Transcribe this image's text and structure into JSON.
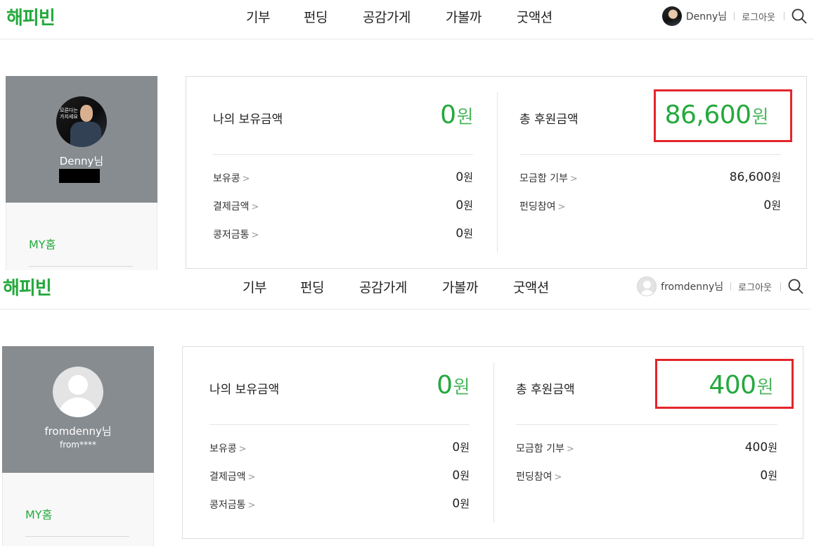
{
  "screens": [
    {
      "header": {
        "logo": "해피빈",
        "nav": [
          "기부",
          "펀딩",
          "공감가게",
          "가볼까",
          "굿액션"
        ],
        "user_name": "Denny님",
        "logout": "로그아웃"
      },
      "profile": {
        "name": "Denny님",
        "id_masked": "",
        "photo_caption": "모른다는\n가지세요",
        "my_home": "MY홈"
      },
      "balance": {
        "label": "나의 보유금액",
        "value": "0",
        "unit": "원",
        "items": [
          {
            "label": "보유콩",
            "value": "0",
            "unit": "원"
          },
          {
            "label": "결제금액",
            "value": "0",
            "unit": "원"
          },
          {
            "label": "콩저금통",
            "value": "0",
            "unit": "원"
          }
        ]
      },
      "donation": {
        "label": "총 후원금액",
        "value": "86,600",
        "unit": "원",
        "items": [
          {
            "label": "모금함 기부",
            "value": "86,600",
            "unit": "원"
          },
          {
            "label": "펀딩참여",
            "value": "0",
            "unit": "원"
          }
        ]
      }
    },
    {
      "header": {
        "logo": "해피빈",
        "nav": [
          "기부",
          "펀딩",
          "공감가게",
          "가볼까",
          "굿액션"
        ],
        "user_name": "fromdenny님",
        "logout": "로그아웃"
      },
      "profile": {
        "name": "fromdenny님",
        "id_masked": "from****",
        "my_home": "MY홈"
      },
      "balance": {
        "label": "나의 보유금액",
        "value": "0",
        "unit": "원",
        "items": [
          {
            "label": "보유콩",
            "value": "0",
            "unit": "원"
          },
          {
            "label": "결제금액",
            "value": "0",
            "unit": "원"
          },
          {
            "label": "콩저금통",
            "value": "0",
            "unit": "원"
          }
        ]
      },
      "donation": {
        "label": "총 후원금액",
        "value": "400",
        "unit": "원",
        "items": [
          {
            "label": "모금함 기부",
            "value": "400",
            "unit": "원"
          },
          {
            "label": "펀딩참여",
            "value": "0",
            "unit": "원"
          }
        ]
      }
    }
  ],
  "icons": {
    "chevron": "chevron-right-icon",
    "search": "search-icon"
  },
  "colors": {
    "brand": "#23a93c",
    "highlight": "#e4252b",
    "profile_bg": "#878c90"
  }
}
